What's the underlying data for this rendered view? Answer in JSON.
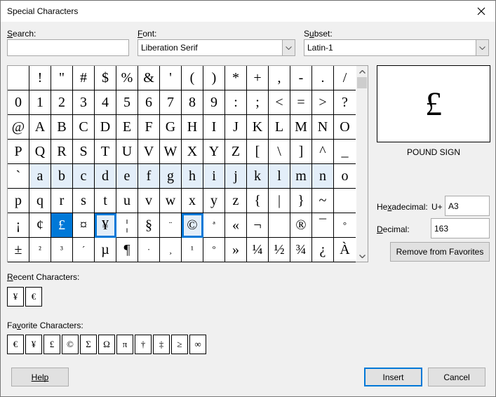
{
  "window": {
    "title": "Special Characters",
    "close_icon": "close-icon"
  },
  "search": {
    "label": "Search:",
    "mnemonic": "S",
    "value": "",
    "placeholder": ""
  },
  "font": {
    "label": "Font:",
    "mnemonic": "F",
    "value": "Liberation Serif"
  },
  "subset": {
    "label": "Subset:",
    "mnemonic": "u",
    "value": "Latin-1"
  },
  "grid": {
    "rows": [
      [
        " ",
        "!",
        "\"",
        "#",
        "$",
        "%",
        "&",
        "'",
        "(",
        ")",
        "*",
        "+",
        ",",
        "-",
        ".",
        "/"
      ],
      [
        "0",
        "1",
        "2",
        "3",
        "4",
        "5",
        "6",
        "7",
        "8",
        "9",
        ":",
        ";",
        "<",
        "=",
        ">",
        "?"
      ],
      [
        "@",
        "A",
        "B",
        "C",
        "D",
        "E",
        "F",
        "G",
        "H",
        "I",
        "J",
        "K",
        "L",
        "M",
        "N",
        "O"
      ],
      [
        "P",
        "Q",
        "R",
        "S",
        "T",
        "U",
        "V",
        "W",
        "X",
        "Y",
        "Z",
        "[",
        "\\",
        "]",
        "^",
        "_"
      ],
      [
        "`",
        "a",
        "b",
        "c",
        "d",
        "e",
        "f",
        "g",
        "h",
        "i",
        "j",
        "k",
        "l",
        "m",
        "n",
        "o"
      ],
      [
        "p",
        "q",
        "r",
        "s",
        "t",
        "u",
        "v",
        "w",
        "x",
        "y",
        "z",
        "{",
        "|",
        "}",
        "~",
        ""
      ],
      [
        "¡",
        "¢",
        "£",
        "¤",
        "¥",
        "¦",
        "§",
        "¨",
        "©",
        "ª",
        "«",
        "¬",
        "",
        "®",
        "¯",
        "°"
      ],
      [
        "±",
        "²",
        "³",
        "´",
        "µ",
        "¶",
        "·",
        "¸",
        "¹",
        "º",
        "»",
        "¼",
        "½",
        "¾",
        "¿",
        "À"
      ]
    ],
    "selected": "£",
    "highlighted_row_index": 4,
    "favorites_marked": [
      "¥",
      "©"
    ]
  },
  "preview": {
    "char": "£",
    "name": "POUND SIGN"
  },
  "hexadecimal": {
    "label": "Hexadecimal:",
    "mnemonic": "x",
    "prefix": "U+",
    "value": "A3"
  },
  "decimal": {
    "label": "Decimal:",
    "mnemonic": "D",
    "value": "163"
  },
  "favorites_button": {
    "label": "Remove from Favorites"
  },
  "recent": {
    "label": "Recent Characters:",
    "mnemonic": "R",
    "chars": [
      "¥",
      "€"
    ]
  },
  "favorites": {
    "label": "Favorite Characters:",
    "mnemonic": "v",
    "chars": [
      "€",
      "¥",
      "£",
      "©",
      "Σ",
      "Ω",
      "π",
      "†",
      "‡",
      "≥",
      "∞"
    ]
  },
  "buttons": {
    "help": "Help",
    "insert": "Insert",
    "cancel": "Cancel"
  },
  "colors": {
    "accent": "#0078d7",
    "highlight_row": "#e3eef9"
  }
}
